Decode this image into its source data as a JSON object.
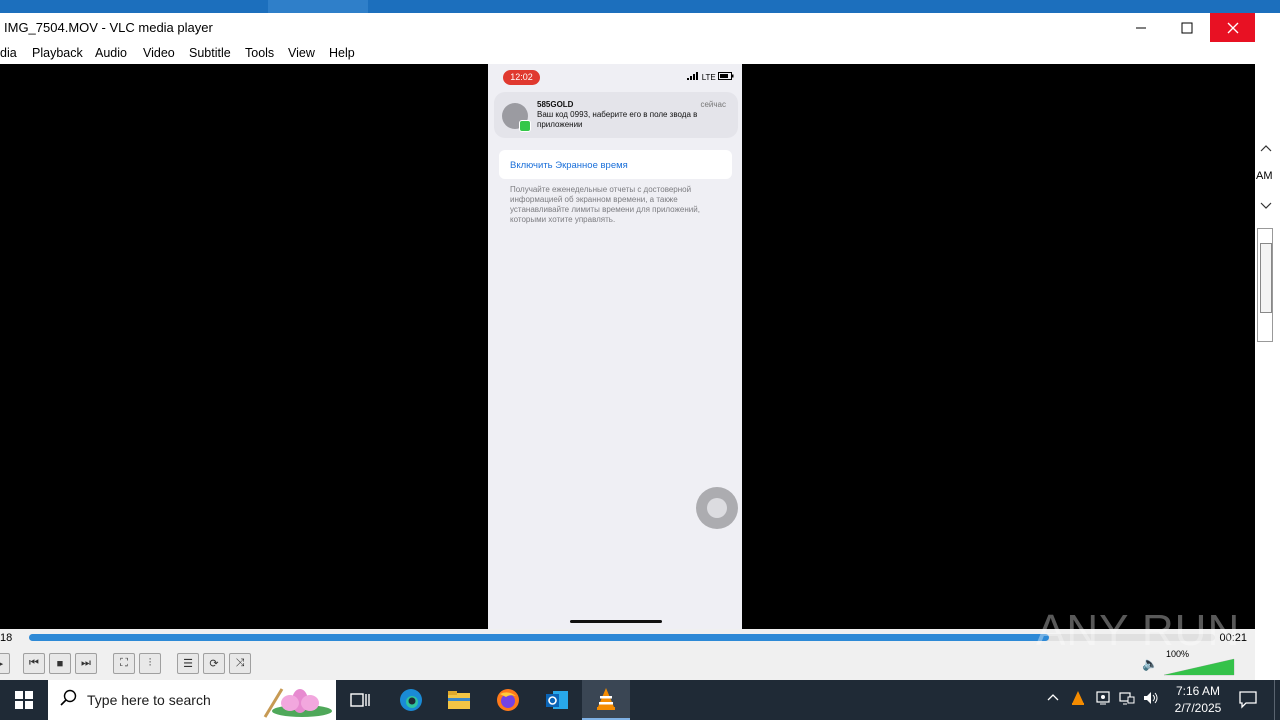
{
  "window": {
    "title": "IMG_7504.MOV - VLC media player",
    "minimize_icon": "minimize-icon",
    "maximize_icon": "maximize-icon",
    "close_icon": "close-icon"
  },
  "menu": [
    "dia",
    "Playback",
    "Audio",
    "Video",
    "Subtitle",
    "Tools",
    "View",
    "Help"
  ],
  "right_panel": {
    "label": "AM"
  },
  "phone": {
    "time": "12:02",
    "network": "LTE",
    "notification": {
      "sender": "585GOLD",
      "time": "сейчас",
      "text": "Ваш код 0993, наберите его в поле звода в приложении"
    },
    "screen_time_link": "Включить Экранное время",
    "screen_time_description": "Получайте еженедельные отчеты с достоверной информацией об экранном времени, а также устанавливайте лимиты времени для приложений, которыми хотите управлять."
  },
  "player": {
    "elapsed": "18",
    "total": "00:21",
    "progress": 0.86,
    "volume_label": "100%",
    "volume": 1.0,
    "accent": "#2d89d6"
  },
  "watermark": "ANY RUN",
  "taskbar": {
    "search_placeholder": "Type here to search",
    "time": "7:16 AM",
    "date": "2/7/2025"
  }
}
